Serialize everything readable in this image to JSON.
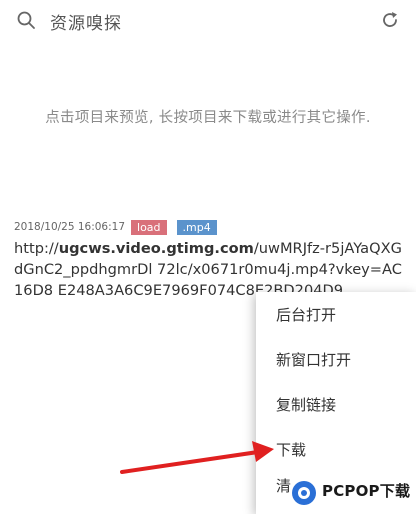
{
  "header": {
    "title": "资源嗅探",
    "search_icon": "search-icon",
    "refresh_icon": "refresh-icon"
  },
  "hint": "点击项目来预览, 长按项目来下载或进行其它操作.",
  "entry": {
    "timestamp": "2018/10/25 16:06:17",
    "tags": [
      "load",
      ".mp4"
    ],
    "url_prefix": "http://",
    "url_host": "ugcws.video.gtimg.com",
    "url_rest": "/uwMRJfz-r5jAYaQXGdGnC2_ppdhgmrDl              72lc/x0671r0mu4j.mp4?vkey=AC16D8                   E248A3A6C9E7969F074C8E2BD204D9                ",
    "tag_colors": {
      "load": "#d9707a",
      "mp4": "#5b93cc"
    }
  },
  "context_menu": {
    "items": [
      "后台打开",
      "新窗口打开",
      "复制链接",
      "下载",
      "清"
    ]
  },
  "watermark": {
    "brand": "PCPOP下载"
  }
}
